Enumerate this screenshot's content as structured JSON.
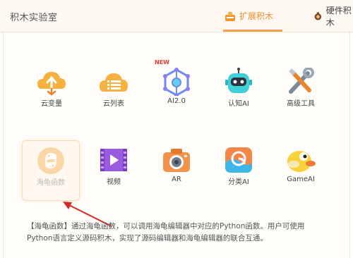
{
  "window": {
    "title": "积木实验室"
  },
  "tabs": [
    {
      "label": "扩展积木",
      "active": true
    },
    {
      "label": "硬件积木",
      "active": false
    }
  ],
  "row1": [
    {
      "label": "云变量",
      "icon": "cloud-variable-icon"
    },
    {
      "label": "云列表",
      "icon": "cloud-list-icon"
    },
    {
      "label": "AI2.0",
      "icon": "ai-network-icon",
      "badge": "NEW"
    },
    {
      "label": "认知AI",
      "icon": "robot-icon"
    },
    {
      "label": "高级工具",
      "icon": "tools-icon"
    }
  ],
  "row2": [
    {
      "label": "海龟函数",
      "icon": "python-icon",
      "selected": true
    },
    {
      "label": "视频",
      "icon": "video-icon"
    },
    {
      "label": "AR",
      "icon": "camera-icon"
    },
    {
      "label": "分类AI",
      "icon": "classify-icon"
    },
    {
      "label": "GameAI",
      "icon": "bird-icon"
    }
  ],
  "description": {
    "line1": "【海龟函数】通过海龟函数，可以调用海龟编辑器中对应的Python函数。用户可使用",
    "line2": "Python语言定义源码积木，实现了源码编辑器和海龟编辑器的联合互通。"
  },
  "colors": {
    "accent": "#e8902d",
    "header_bg": "#fdf8f1",
    "arrow": "#d22b2b"
  }
}
